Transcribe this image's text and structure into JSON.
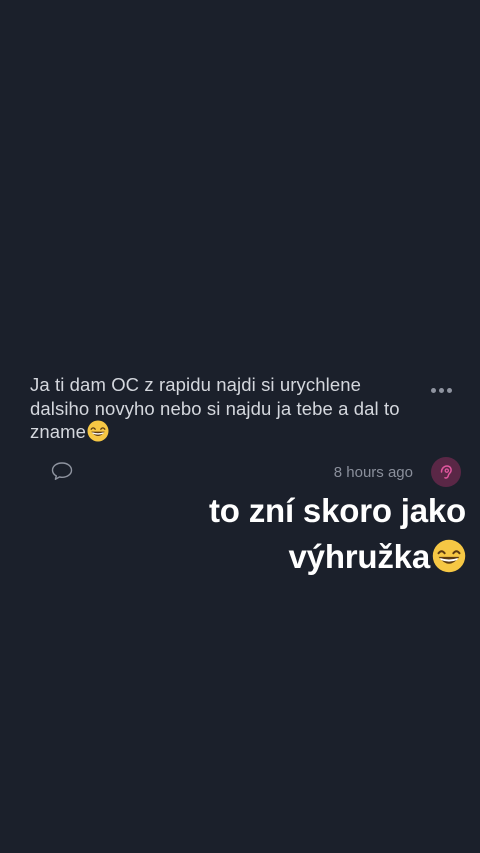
{
  "comment": {
    "text": "Ja ti dam OC z rapidu najdi si urychlene dalsiho novyho nebo si najdu ja tebe a dal to zname",
    "emoji": "grinning-face-with-smiling-eyes",
    "timestamp": "8 hours ago",
    "more_icon": "more-horizontal-icon",
    "reply_icon": "speech-bubble-icon",
    "avatar_icon": "user-avatar-icon",
    "avatar_color": "#5a2746",
    "avatar_accent": "#e0569e"
  },
  "overlay": {
    "line1": "to zní skoro jako",
    "line2": "výhružka",
    "emoji": "grinning-face-with-smiling-eyes"
  },
  "colors": {
    "background": "#1b202b",
    "comment_text": "#d4d7dd",
    "muted": "#8a8f9b",
    "overlay_text": "#ffffff"
  }
}
